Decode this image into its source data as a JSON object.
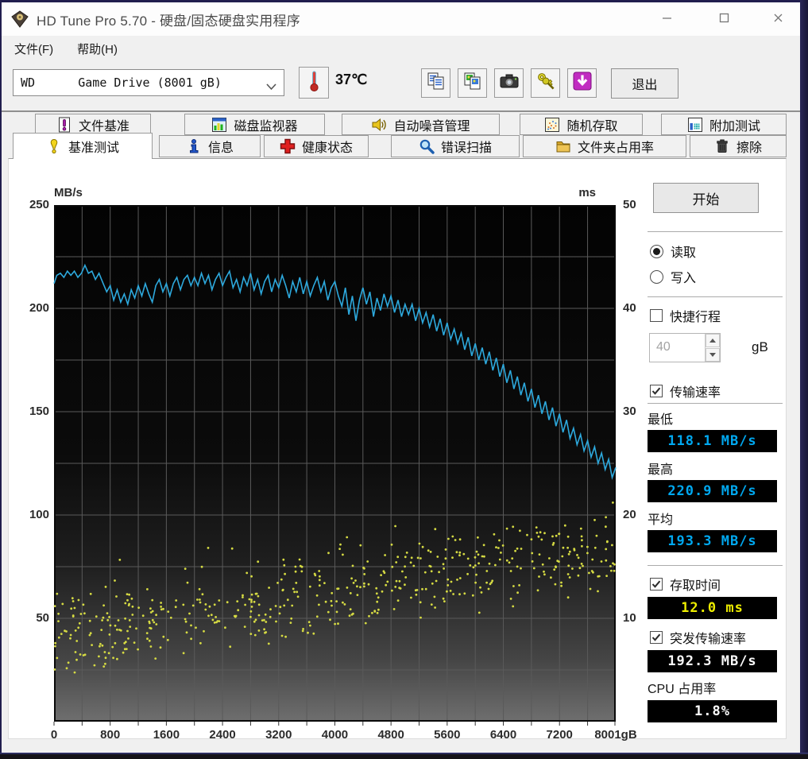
{
  "window": {
    "title": "HD Tune Pro 5.70 - 硬盘/固态硬盘实用程序",
    "controls": [
      {
        "name": "minimize-button",
        "icon": "minimize-icon"
      },
      {
        "name": "maximize-button",
        "icon": "maximize-icon"
      },
      {
        "name": "close-button",
        "icon": "close-icon"
      }
    ]
  },
  "menu": {
    "items": [
      {
        "label": "文件(F)"
      },
      {
        "label": "帮助(H)"
      }
    ]
  },
  "toolbar": {
    "drive_select_value": "WD      Game Drive (8001 gB)",
    "temperature": "37℃",
    "buttons": [
      {
        "name": "copy-text"
      },
      {
        "name": "copy-image"
      },
      {
        "name": "screenshot"
      },
      {
        "name": "keys"
      },
      {
        "name": "save-download"
      }
    ],
    "exit_label": "退出"
  },
  "tabs": {
    "row1": [
      {
        "icon": "exclaim-doc-icon",
        "label": "文件基准"
      },
      {
        "icon": "monitor-chart-icon",
        "label": "磁盘监视器"
      },
      {
        "icon": "speaker-icon",
        "label": "自动噪音管理"
      },
      {
        "icon": "random-dots-icon",
        "label": "随机存取"
      },
      {
        "icon": "extra-tests-icon",
        "label": "附加测试"
      }
    ],
    "row2": [
      {
        "icon": "exclaim-icon",
        "label": "基准测试",
        "active": true
      },
      {
        "icon": "info-icon",
        "label": "信息"
      },
      {
        "icon": "health-icon",
        "label": "健康状态"
      },
      {
        "icon": "scan-icon",
        "label": "错误扫描"
      },
      {
        "icon": "folder-icon",
        "label": "文件夹占用率"
      },
      {
        "icon": "erase-icon",
        "label": "擦除"
      }
    ]
  },
  "chart_data": {
    "type": "line+scatter",
    "x_axis": {
      "min": 0,
      "max": 8001,
      "grid_step": 400,
      "ticks": [
        {
          "v": 0,
          "label": "0"
        },
        {
          "v": 800,
          "label": "800"
        },
        {
          "v": 1600,
          "label": "1600"
        },
        {
          "v": 2400,
          "label": "2400"
        },
        {
          "v": 3200,
          "label": "3200"
        },
        {
          "v": 4000,
          "label": "4000"
        },
        {
          "v": 4800,
          "label": "4800"
        },
        {
          "v": 5600,
          "label": "5600"
        },
        {
          "v": 6400,
          "label": "6400"
        },
        {
          "v": 7200,
          "label": "7200"
        },
        {
          "v": 8001,
          "label": "8001gB"
        }
      ]
    },
    "y_left": {
      "unit": "MB/s",
      "min": 0,
      "max": 250,
      "ticks": [
        250,
        200,
        150,
        100,
        50
      ],
      "grid_step": 25
    },
    "y_right": {
      "unit": "ms",
      "min": 0,
      "max": 50,
      "ticks": [
        50,
        40,
        30,
        20,
        10
      ]
    },
    "grid_color": "#5a5a5a",
    "series": [
      {
        "name": "transfer-rate",
        "type": "line",
        "axis": "left",
        "color": "#2da9dd",
        "points": [
          [
            0,
            212
          ],
          [
            40,
            216
          ],
          [
            90,
            217
          ],
          [
            140,
            215
          ],
          [
            190,
            218
          ],
          [
            240,
            216
          ],
          [
            290,
            218
          ],
          [
            340,
            215
          ],
          [
            390,
            217
          ],
          [
            440,
            220.9
          ],
          [
            490,
            217
          ],
          [
            540,
            218
          ],
          [
            590,
            214
          ],
          [
            640,
            217
          ],
          [
            700,
            212
          ],
          [
            750,
            208
          ],
          [
            800,
            211
          ],
          [
            850,
            204
          ],
          [
            900,
            209
          ],
          [
            950,
            203
          ],
          [
            1000,
            207
          ],
          [
            1050,
            202
          ],
          [
            1100,
            209
          ],
          [
            1150,
            205
          ],
          [
            1200,
            211
          ],
          [
            1250,
            206
          ],
          [
            1300,
            212
          ],
          [
            1350,
            207
          ],
          [
            1400,
            203
          ],
          [
            1450,
            211
          ],
          [
            1500,
            214
          ],
          [
            1550,
            208
          ],
          [
            1600,
            212
          ],
          [
            1650,
            206
          ],
          [
            1700,
            212
          ],
          [
            1750,
            215
          ],
          [
            1800,
            209
          ],
          [
            1850,
            214
          ],
          [
            1900,
            216
          ],
          [
            1950,
            211
          ],
          [
            2000,
            215
          ],
          [
            2050,
            211
          ],
          [
            2100,
            217
          ],
          [
            2150,
            212
          ],
          [
            2200,
            216
          ],
          [
            2250,
            209
          ],
          [
            2300,
            214
          ],
          [
            2350,
            217
          ],
          [
            2400,
            211
          ],
          [
            2450,
            215
          ],
          [
            2500,
            218
          ],
          [
            2550,
            210
          ],
          [
            2600,
            214
          ],
          [
            2650,
            208
          ],
          [
            2700,
            215
          ],
          [
            2750,
            211
          ],
          [
            2800,
            217
          ],
          [
            2850,
            209
          ],
          [
            2900,
            214
          ],
          [
            2950,
            207
          ],
          [
            3000,
            213
          ],
          [
            3050,
            216
          ],
          [
            3100,
            208
          ],
          [
            3150,
            214
          ],
          [
            3200,
            210
          ],
          [
            3250,
            216
          ],
          [
            3300,
            211
          ],
          [
            3350,
            205
          ],
          [
            3400,
            213
          ],
          [
            3450,
            208
          ],
          [
            3500,
            215
          ],
          [
            3550,
            207
          ],
          [
            3600,
            213
          ],
          [
            3650,
            206
          ],
          [
            3700,
            211
          ],
          [
            3750,
            215
          ],
          [
            3800,
            208
          ],
          [
            3850,
            213
          ],
          [
            3900,
            204
          ],
          [
            3950,
            210
          ],
          [
            4000,
            213
          ],
          [
            4050,
            206
          ],
          [
            4100,
            201
          ],
          [
            4150,
            210
          ],
          [
            4200,
            197
          ],
          [
            4250,
            206
          ],
          [
            4300,
            194
          ],
          [
            4350,
            204
          ],
          [
            4400,
            210
          ],
          [
            4450,
            202
          ],
          [
            4500,
            208
          ],
          [
            4550,
            196
          ],
          [
            4600,
            205
          ],
          [
            4650,
            199
          ],
          [
            4700,
            207
          ],
          [
            4750,
            201
          ],
          [
            4800,
            206
          ],
          [
            4850,
            198
          ],
          [
            4900,
            204
          ],
          [
            4950,
            196
          ],
          [
            5000,
            202
          ],
          [
            5050,
            197
          ],
          [
            5100,
            202
          ],
          [
            5150,
            194
          ],
          [
            5200,
            200
          ],
          [
            5250,
            193
          ],
          [
            5300,
            198
          ],
          [
            5350,
            191
          ],
          [
            5400,
            197
          ],
          [
            5450,
            189
          ],
          [
            5500,
            195
          ],
          [
            5550,
            187
          ],
          [
            5600,
            193
          ],
          [
            5650,
            185
          ],
          [
            5700,
            190
          ],
          [
            5750,
            183
          ],
          [
            5800,
            188
          ],
          [
            5850,
            180
          ],
          [
            5900,
            186
          ],
          [
            5950,
            177
          ],
          [
            6000,
            183
          ],
          [
            6050,
            175
          ],
          [
            6100,
            181
          ],
          [
            6150,
            173
          ],
          [
            6200,
            179
          ],
          [
            6250,
            170
          ],
          [
            6300,
            176
          ],
          [
            6350,
            167
          ],
          [
            6400,
            173
          ],
          [
            6450,
            164
          ],
          [
            6500,
            170
          ],
          [
            6550,
            161
          ],
          [
            6600,
            167
          ],
          [
            6650,
            158
          ],
          [
            6700,
            164
          ],
          [
            6750,
            155
          ],
          [
            6800,
            161
          ],
          [
            6850,
            152
          ],
          [
            6900,
            158
          ],
          [
            6950,
            149
          ],
          [
            7000,
            155
          ],
          [
            7050,
            146
          ],
          [
            7100,
            152
          ],
          [
            7150,
            143
          ],
          [
            7200,
            149
          ],
          [
            7250,
            140
          ],
          [
            7300,
            146
          ],
          [
            7350,
            137
          ],
          [
            7400,
            142
          ],
          [
            7450,
            134
          ],
          [
            7500,
            139
          ],
          [
            7550,
            131
          ],
          [
            7600,
            136
          ],
          [
            7650,
            128
          ],
          [
            7700,
            133
          ],
          [
            7750,
            125
          ],
          [
            7800,
            130
          ],
          [
            7850,
            122
          ],
          [
            7900,
            127
          ],
          [
            7950,
            118.1
          ],
          [
            8001,
            123
          ]
        ]
      },
      {
        "name": "access-time",
        "type": "scatter",
        "axis": "right",
        "color": "#d6db43",
        "generator": {
          "seed": 13,
          "count": 520,
          "ms_low_start": 4,
          "ms_low_end": 12,
          "ms_high_start": 13.5,
          "ms_high_end": 21,
          "outlier_rate": 0.02
        }
      }
    ]
  },
  "panel": {
    "start_button": "开始",
    "mode": {
      "read_label": "读取",
      "write_label": "写入",
      "selected": "read"
    },
    "short_stroke": {
      "label": "快捷行程",
      "checked": false,
      "value": "40",
      "unit": "gB"
    },
    "transfer": {
      "label": "传输速率",
      "checked": true,
      "min_label": "最低",
      "min_value": "118.1 MB/s",
      "max_label": "最高",
      "max_value": "220.9 MB/s",
      "avg_label": "平均",
      "avg_value": "193.3 MB/s"
    },
    "access": {
      "label": "存取时间",
      "checked": true,
      "value": "12.0 ms"
    },
    "burst": {
      "label": "突发传输速率",
      "checked": true,
      "value": "192.3 MB/s"
    },
    "cpu": {
      "label": "CPU 占用率",
      "value": "1.8%"
    }
  }
}
